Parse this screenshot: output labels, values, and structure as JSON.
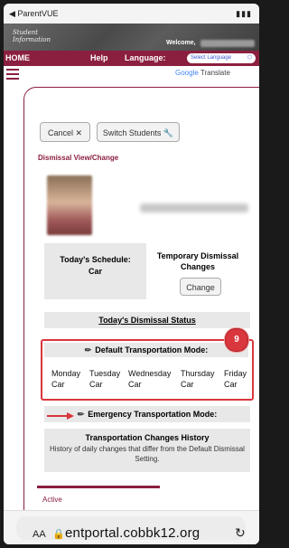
{
  "ios_status": {
    "back_label": "◀ ParentVUE"
  },
  "banner": {
    "logo_line1": "Student",
    "logo_line2": "Information",
    "welcome": "Welcome,"
  },
  "navbar": {
    "home": "HOME",
    "help": "Help",
    "language": "Language:",
    "select_language": "Select Language"
  },
  "translate": {
    "google": "Google",
    "translate": "Translate"
  },
  "buttons": {
    "cancel": "Cancel ✕",
    "switch": "Switch Students 🔧",
    "change": "Change"
  },
  "page": {
    "section_title": "Dismissal View/Change",
    "schedule_title": "Today's Schedule:",
    "schedule_value": "Car",
    "temp_title": "Temporary Dismissal Changes",
    "status_title": "Today's Dismissal Status",
    "default_title": "Default Transportation Mode:",
    "days": [
      {
        "day": "Monday",
        "mode": "Car"
      },
      {
        "day": "Tuesday",
        "mode": "Car"
      },
      {
        "day": "Wednesday",
        "mode": "Car"
      },
      {
        "day": "Thursday",
        "mode": "Car"
      },
      {
        "day": "Friday",
        "mode": "Car"
      }
    ],
    "badge": "9",
    "emergency_title": "Emergency Transportation Mode:",
    "history_title": "Transportation Changes History",
    "history_sub": "History of daily changes that differ from the Default Dismissal Setting.",
    "active_tab": "Active"
  },
  "urlbar": {
    "aa": "AA",
    "url": "entportal.cobbk12.org"
  },
  "colors": {
    "brand": "#8b1f3f",
    "highlight": "#d9363e"
  }
}
